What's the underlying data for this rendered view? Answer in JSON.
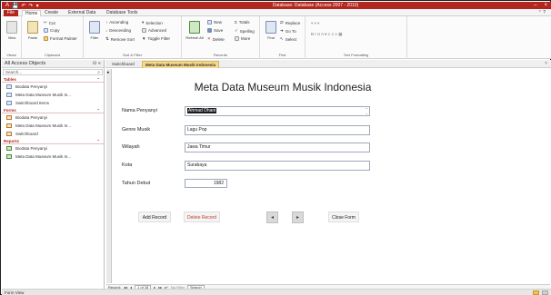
{
  "window": {
    "title": "Database: Database (Access 2007 - 2010)",
    "controls": {
      "minimize": "–",
      "close": "×"
    }
  },
  "qat": {
    "app_icon": "A",
    "save": "💾",
    "undo": "↶",
    "redo": "↷",
    "customize": "▾"
  },
  "ribbon_tabs": [
    "File",
    "Home",
    "Create",
    "External Data",
    "Database Tools"
  ],
  "help": "⌃ ?",
  "ribbon": {
    "views": {
      "view_label": "View",
      "group_label": "Views"
    },
    "clipboard": {
      "paste_label": "Paste",
      "cut_label": "Cut",
      "copy_label": "Copy",
      "painter_label": "Format Painter",
      "group_label": "Clipboard"
    },
    "sort_filter": {
      "filter_label": "Filter",
      "ascending_label": "Ascending",
      "descending_label": "Descending",
      "remove_sort_label": "Remove Sort",
      "selection_label": "Selection",
      "advanced_label": "Advanced",
      "toggle_filter_label": "Toggle Filter",
      "group_label": "Sort & Filter"
    },
    "records": {
      "refresh_label": "Refresh All",
      "new_label": "New",
      "save_label": "Save",
      "delete_label": "Delete",
      "totals_label": "Totals",
      "spelling_label": "Spelling",
      "more_label": "More",
      "group_label": "Records"
    },
    "find": {
      "find_label": "Find",
      "replace_label": "Replace",
      "goto_label": "Go To",
      "select_label": "Select",
      "group_label": "Find"
    },
    "text_formatting": {
      "group_label": "Text Formatting"
    }
  },
  "nav_pane": {
    "header": "All Access Objects",
    "search_placeholder": "Search...",
    "sections": [
      {
        "title": "Tables",
        "items": [
          "Biodata Penyanyi",
          "Meta Data Museum Musik In...",
          "Switchboard Items"
        ]
      },
      {
        "title": "Forms",
        "items": [
          "Biodata Penyanyi",
          "Meta Data Museum Musik In...",
          "Switchboard"
        ]
      },
      {
        "title": "Reports",
        "items": [
          "Biodata Penyanyi",
          "Meta Data Museum Musik In..."
        ]
      }
    ]
  },
  "doc_tabs": [
    "Switchboard",
    "Meta Data Museum Musik Indonesia"
  ],
  "form": {
    "title": "Meta Data Museum Musik Indonesia",
    "fields": [
      {
        "label": "Nama Penyanyi",
        "value": "Ahmad Dhani"
      },
      {
        "label": "Genre Musik",
        "value": "Lagu Pop"
      },
      {
        "label": "Wilayah",
        "value": "Jawa Timur"
      },
      {
        "label": "Kota",
        "value": "Surabaya"
      },
      {
        "label": "Tahun Debut",
        "value": "1982"
      }
    ],
    "buttons": {
      "add": "Add Record",
      "delete": "Delete Record",
      "prev": "◂",
      "next": "▸",
      "close": "Close Form"
    }
  },
  "record_nav": {
    "prefix": "Record:",
    "position": "1 of 18",
    "first": "◂◂",
    "prev": "◂",
    "next": "▸",
    "last": "▸▸",
    "new": "▸*",
    "filter": "No Filter",
    "search": "Search"
  },
  "status": {
    "text": "Form View"
  },
  "colors": {
    "accent": "#b3261e",
    "tab_highlight": "#f7d98b"
  }
}
